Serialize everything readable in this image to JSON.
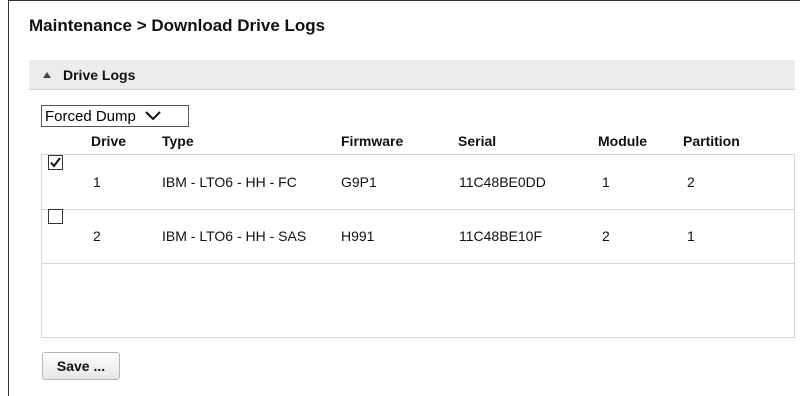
{
  "breadcrumb": "Maintenance > Download Drive Logs",
  "section": {
    "title": "Drive Logs",
    "expanded": true
  },
  "dump_type": {
    "selected": "Forced Dump"
  },
  "table": {
    "columns": [
      "Drive",
      "Type",
      "Firmware",
      "Serial",
      "Module",
      "Partition"
    ],
    "rows": [
      {
        "checked": true,
        "drive": "1",
        "type": "IBM - LTO6 - HH - FC",
        "firmware": "G9P1",
        "serial": "11C48BE0DD",
        "module": "1",
        "partition": "2"
      },
      {
        "checked": false,
        "drive": "2",
        "type": "IBM - LTO6 - HH - SAS",
        "firmware": "H991",
        "serial": "11C48BE10F",
        "module": "2",
        "partition": "1"
      }
    ]
  },
  "save_label": "Save ..."
}
